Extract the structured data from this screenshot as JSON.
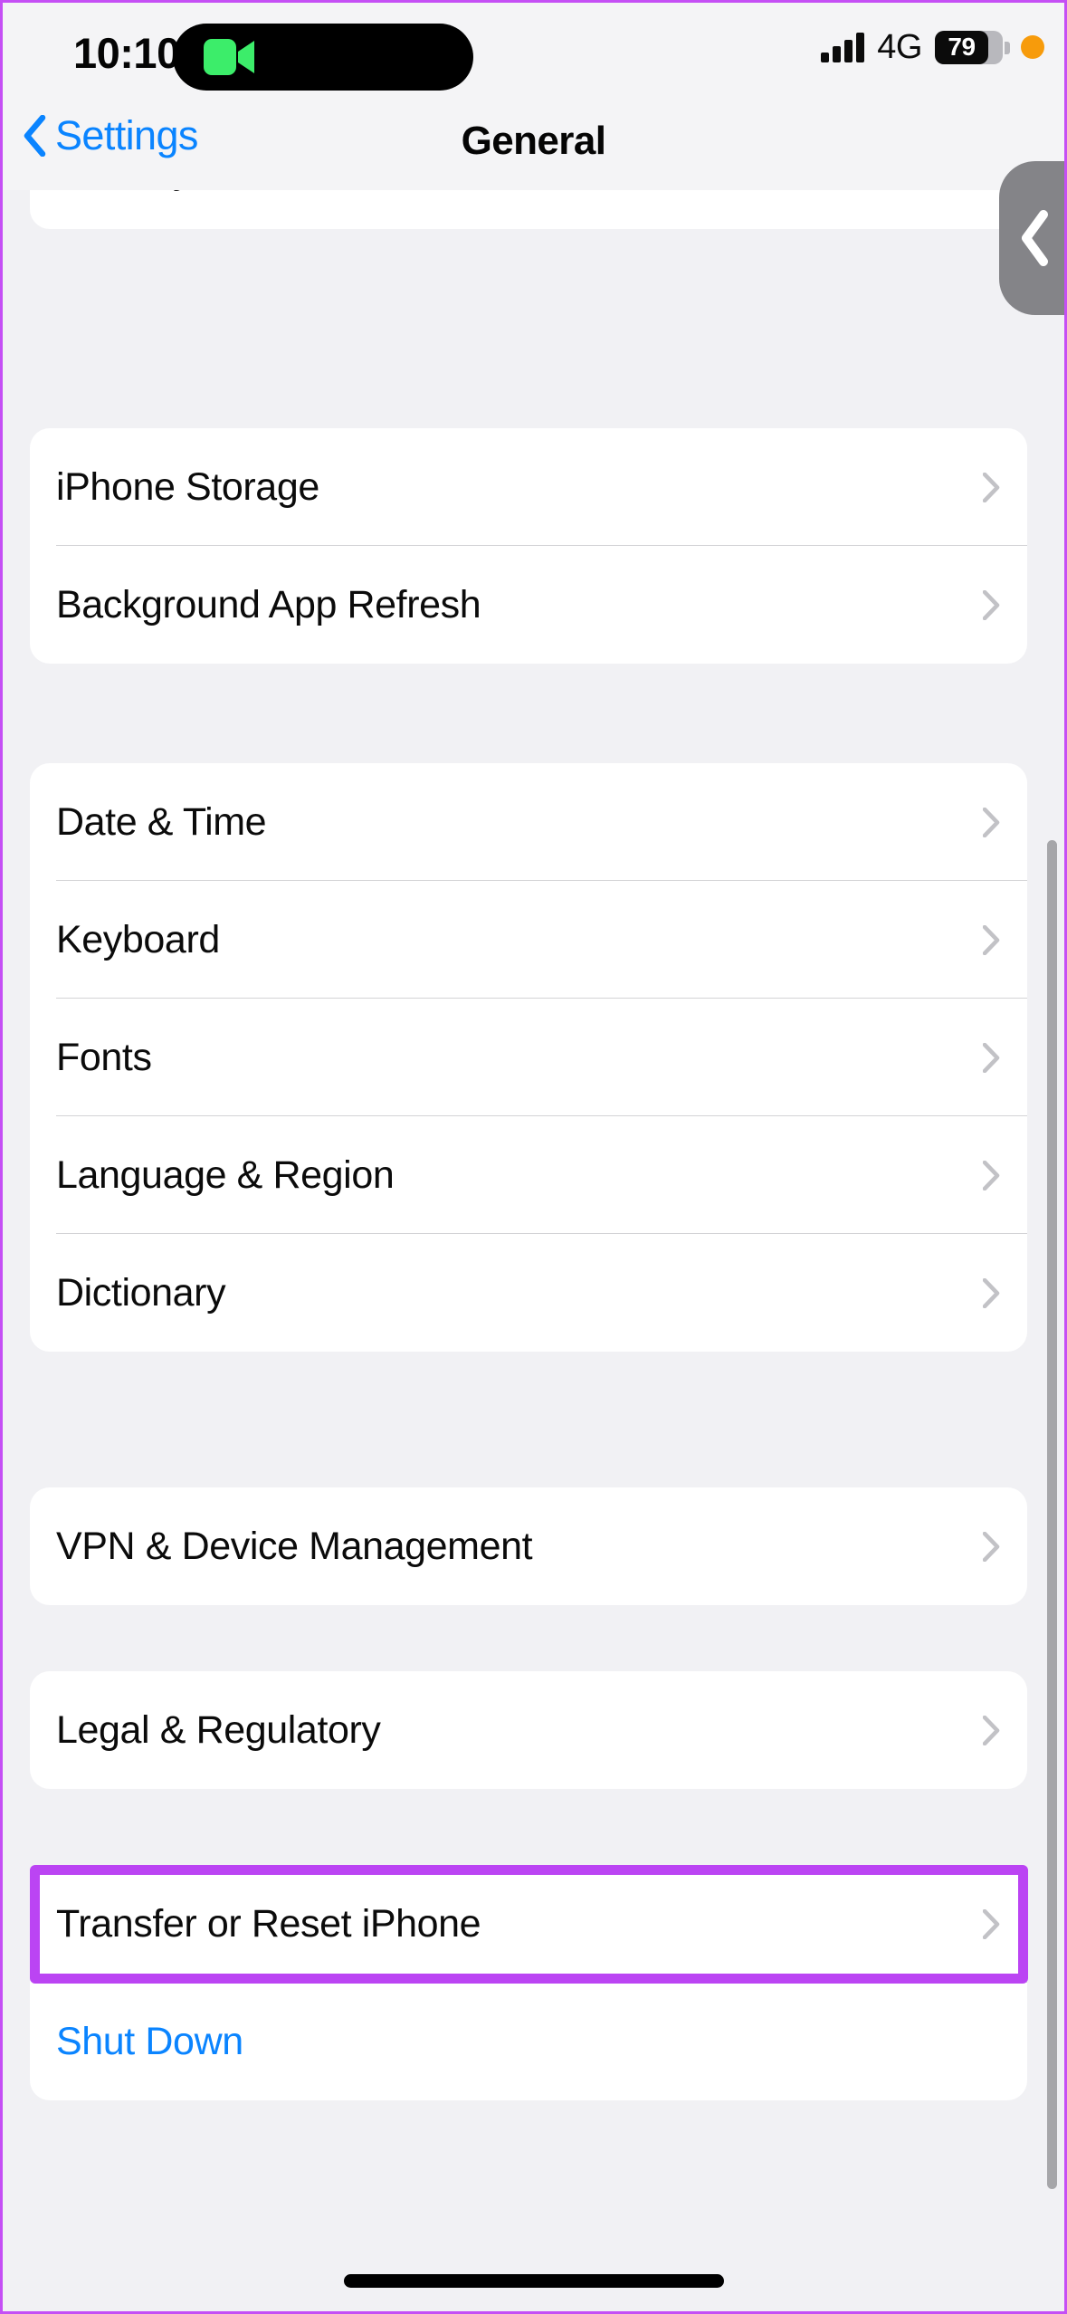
{
  "status_bar": {
    "time": "10:10",
    "network_type": "4G",
    "battery_percent": "79",
    "battery_level": 79,
    "signal_bars": 4,
    "icons": {
      "facetime": "facetime-camera-icon",
      "privacy_indicator": "orange-privacy-dot"
    }
  },
  "nav_bar": {
    "back_label": "Settings",
    "title": "General"
  },
  "accent_colors": {
    "link_blue": "#0a84ff",
    "highlight_purple": "#bb44f3",
    "facetime_green": "#3ced6a",
    "privacy_orange": "#f79b0b"
  },
  "groups": [
    {
      "id": "carplay-group",
      "clipped_top": true,
      "rows": [
        {
          "label": "CarPlay",
          "style": "default",
          "chevron": true
        }
      ]
    },
    {
      "id": "storage-group",
      "rows": [
        {
          "label": "iPhone Storage",
          "style": "default",
          "chevron": true
        },
        {
          "label": "Background App Refresh",
          "style": "default",
          "chevron": true
        }
      ]
    },
    {
      "id": "locale-group",
      "rows": [
        {
          "label": "Date & Time",
          "style": "default",
          "chevron": true
        },
        {
          "label": "Keyboard",
          "style": "default",
          "chevron": true
        },
        {
          "label": "Fonts",
          "style": "default",
          "chevron": true
        },
        {
          "label": "Language & Region",
          "style": "default",
          "chevron": true
        },
        {
          "label": "Dictionary",
          "style": "default",
          "chevron": true
        }
      ]
    },
    {
      "id": "vpn-group",
      "rows": [
        {
          "label": "VPN & Device Management",
          "style": "default",
          "chevron": true
        }
      ]
    },
    {
      "id": "legal-group",
      "rows": [
        {
          "label": "Legal & Regulatory",
          "style": "default",
          "chevron": true
        }
      ]
    },
    {
      "id": "reset-group",
      "rows": [
        {
          "label": "Transfer or Reset iPhone",
          "style": "default",
          "chevron": true,
          "highlighted": true
        },
        {
          "label": "Shut Down",
          "style": "blue",
          "chevron": false
        }
      ]
    }
  ],
  "back_affordance": {
    "icon": "chevron-left-icon"
  },
  "scrollbar": {
    "visible": true
  },
  "home_indicator": {
    "visible": true
  }
}
